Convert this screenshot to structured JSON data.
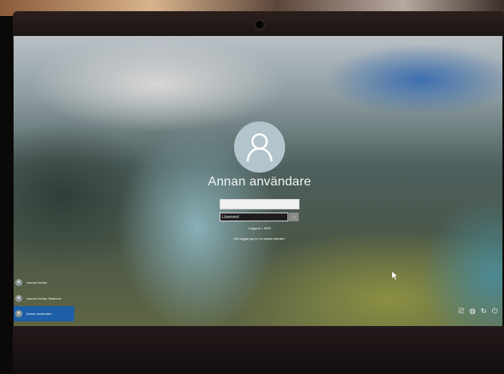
{
  "login": {
    "username": "Annan användare",
    "user_field_value": "",
    "password_placeholder": "Lösenord",
    "submit_glyph": "→",
    "sign_in_to": "Logga in i: NHR",
    "other_domain_link": "Hur loggar jag in i en annan domän?"
  },
  "user_list": [
    {
      "label": "Joanna Hedby",
      "icon": "user-icon",
      "selected": false
    },
    {
      "label": "Joanna Hedby Testkonto",
      "icon": "user-icon",
      "selected": false
    },
    {
      "label": "Annan användare",
      "icon": "user-icon",
      "selected": true
    }
  ],
  "tray": [
    {
      "icon": "network-icon",
      "glyph": "⎚"
    },
    {
      "icon": "globe-icon",
      "glyph": "◍"
    },
    {
      "icon": "accessibility-icon",
      "glyph": "↻"
    },
    {
      "icon": "power-icon",
      "glyph": "⏻"
    }
  ],
  "colors": {
    "selected_item": "#1d5fa8",
    "avatar": "#b4c4cc",
    "password_field": "#1e1e1e"
  }
}
